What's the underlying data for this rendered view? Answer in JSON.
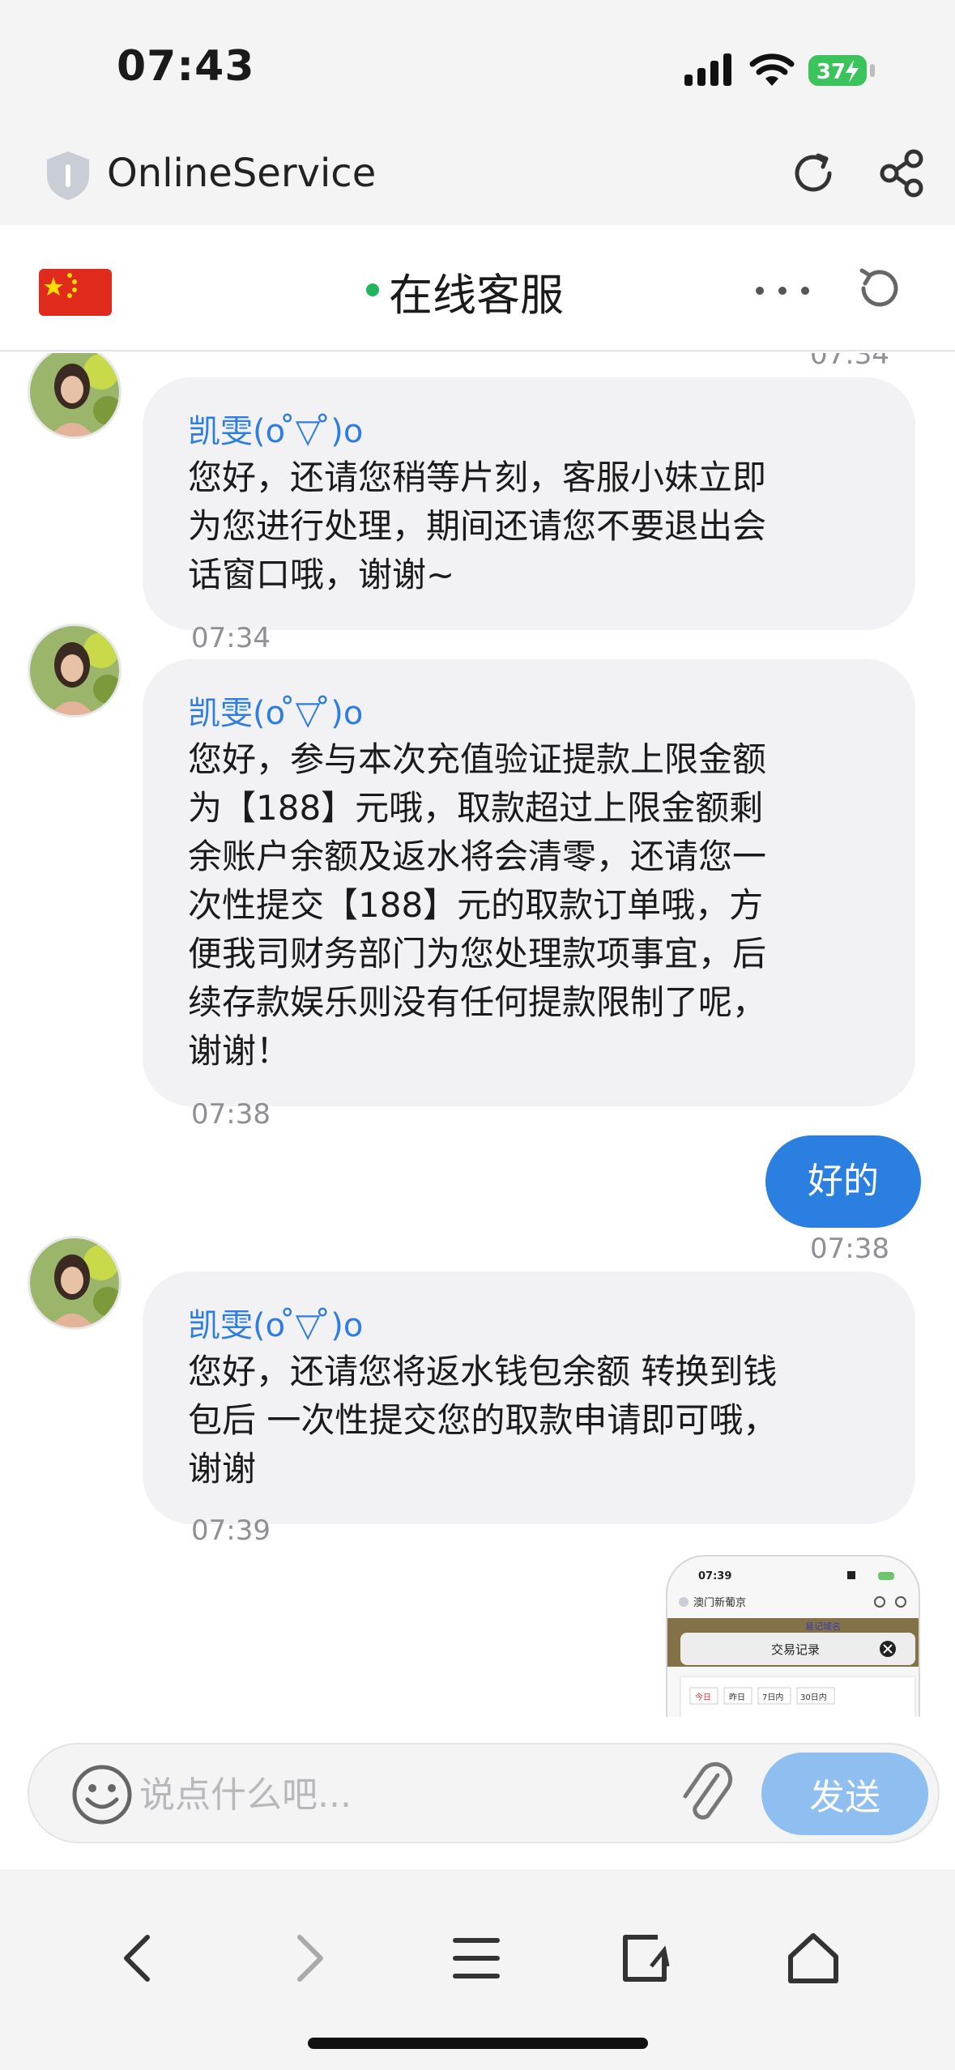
{
  "status_bar": {
    "time": "07:43",
    "battery": "37"
  },
  "browser": {
    "title": "OnlineService"
  },
  "chat_header": {
    "title": "在线客服"
  },
  "messages": [
    {
      "time": "07:34",
      "sender": "凯雯(o ̊▽ ̊)o",
      "text": "您好，还请您稍等片刻，客服小妹立即\n为您进行处理，期间还请您不要退出会\n话窗口哦，谢谢~"
    },
    {
      "time": "07:34",
      "sender": "凯雯(o ̊▽ ̊)o",
      "text": "您好，参与本次充值验证提款上限金额\n为【188】元哦，取款超过上限金额剩\n余账户余额及返水将会清零，还请您一\n次性提交【188】元的取款订单哦，方\n便我司财务部门为您处理款项事宜，后\n续存款娱乐则没有任何提款限制了呢，\n谢谢！"
    },
    {
      "time": "07:38",
      "self": true,
      "text": "好的",
      "self_time": "07:38"
    },
    {
      "time": "07:39",
      "sender": "凯雯(o ̊▽ ̊)o",
      "text": "您好，还请您将返水钱包余额 转换到钱\n包后 一次性提交您的取款申请即可哦，\n谢谢"
    }
  ],
  "thumbnail": {
    "time": "07:39",
    "site": "澳门新葡京",
    "badge": "易记域名",
    "dialog_title": "交易记录",
    "tabs": [
      "今日",
      "昨日",
      "7日内",
      "30日内"
    ]
  },
  "input": {
    "placeholder": "说点什么吧...",
    "send_label": "发送"
  },
  "colors": {
    "accent": "#2a7fe0",
    "send_disabled": "#8fbef0",
    "sender_name": "#2e7de0",
    "online": "#22b35c"
  }
}
